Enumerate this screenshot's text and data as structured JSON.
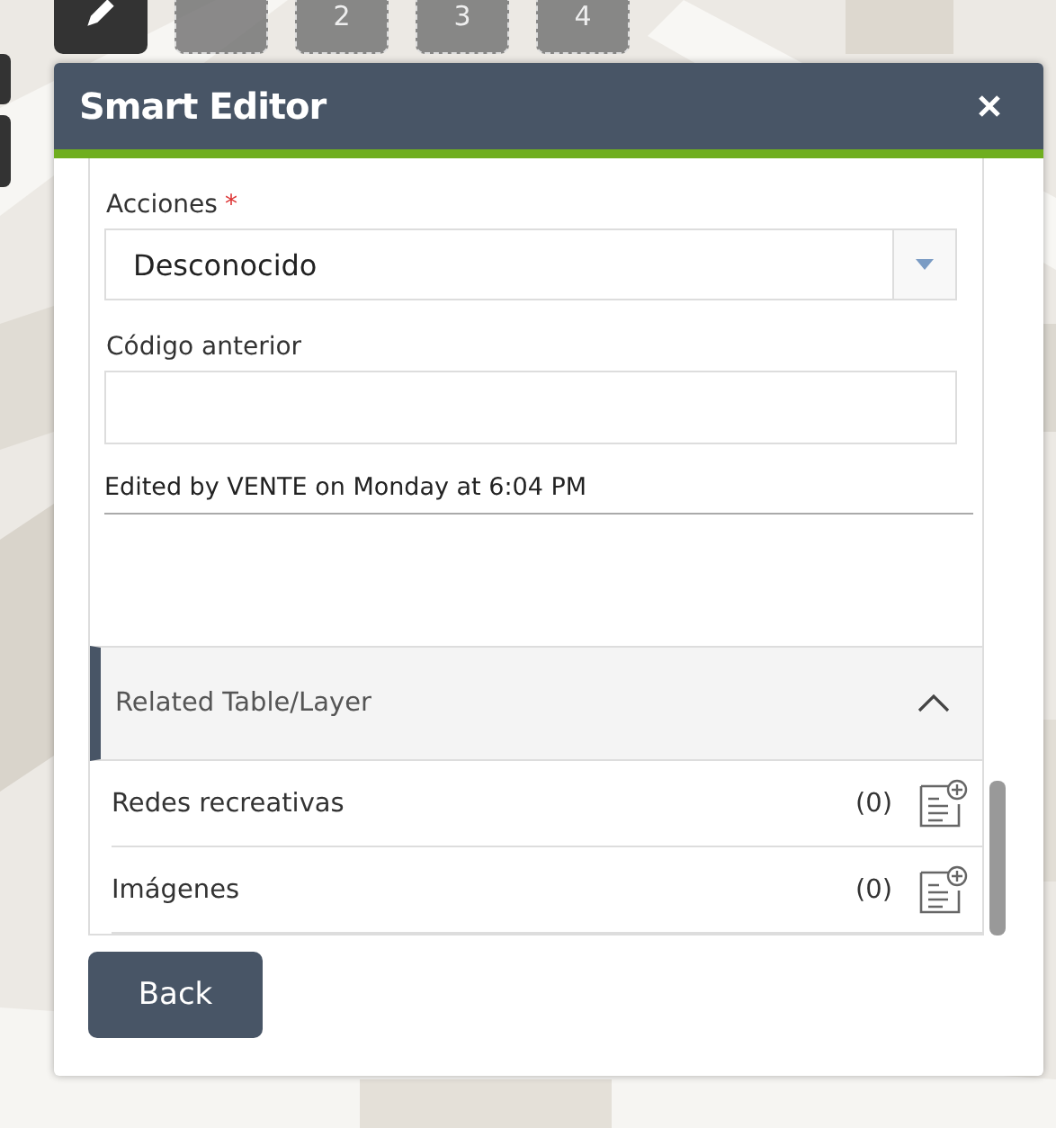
{
  "toolbar": [
    {
      "kind": "edit",
      "selected": true
    },
    {
      "kind": "slot",
      "selected": false
    },
    {
      "kind": "slot",
      "label": "2",
      "selected": false
    },
    {
      "kind": "slot",
      "label": "3",
      "selected": false
    },
    {
      "kind": "slot",
      "label": "4",
      "selected": false
    }
  ],
  "panel": {
    "title": "Smart Editor",
    "required_mark": "*",
    "fields": [
      {
        "kind": "select",
        "label": "Acciones",
        "required": true,
        "value": "Desconocido"
      },
      {
        "kind": "text",
        "label": "Código anterior",
        "required": false
      }
    ],
    "edit_info": "Edited by VENTE on Monday at 6:04 PM",
    "related": {
      "title": "Related Table/Layer",
      "expanded": true,
      "rows": [
        {
          "name": "Redes recreativas",
          "count": "(0)"
        },
        {
          "name": "Imágenes",
          "count": "(0)"
        }
      ]
    },
    "back_button": "Back"
  }
}
